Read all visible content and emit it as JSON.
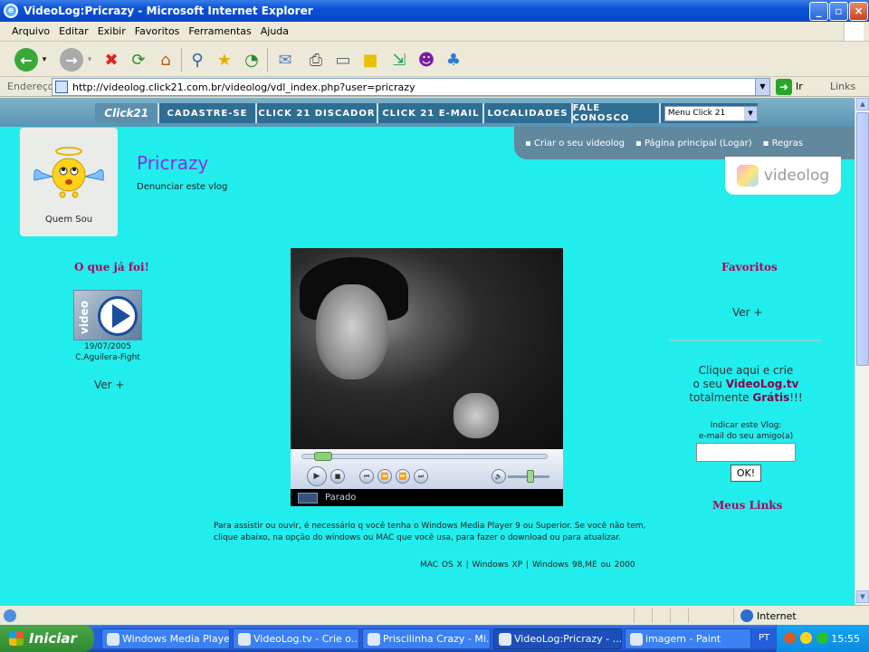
{
  "window": {
    "title": "VideoLog:Pricrazy - Microsoft Internet Explorer"
  },
  "menubar": [
    "Arquivo",
    "Editar",
    "Exibir",
    "Favoritos",
    "Ferramentas",
    "Ajuda"
  ],
  "address": {
    "label": "Endereço",
    "url": "http://videolog.click21.com.br/videolog/vdl_index.php?user=pricrazy",
    "go": "Ir",
    "links": "Links"
  },
  "site": {
    "logo": "Click21",
    "nav": [
      "CADASTRE-SE",
      "CLICK 21 DISCADOR",
      "CLICK 21 E-MAIL",
      "LOCALIDADES",
      "FALE CONOSCO"
    ],
    "menu_select": "Menu Click 21",
    "submenu": [
      "Criar o seu videolog",
      "Página principal (Logar)",
      "Regras"
    ],
    "videolog_logo": "videolog"
  },
  "profile": {
    "label": "Quem Sou",
    "username": "Pricrazy",
    "report": "Denunciar este vlog"
  },
  "left": {
    "heading": "O que já foi!",
    "thumb_label": "video",
    "date": "19/07/2005",
    "title": "C.Aguilera-Fight",
    "more": "Ver +"
  },
  "player": {
    "status": "Parado",
    "progress": 0.05,
    "volume": 0.55
  },
  "info": {
    "text": "Para assistir ou ouvir, é necessário q você tenha o Windows Media Player 9 ou Superior. Se você não tem, clique abaixo, na opção do windows ou MAC que você usa, para fazer o download ou para atualizar.",
    "os_links": [
      "MAC OS X",
      "Windows XP",
      "Windows 98,ME ou 2000"
    ]
  },
  "right": {
    "favorites": "Favoritos",
    "more": "Ver +",
    "cta_1": "Clique aqui e crie",
    "cta_2": "o seu",
    "cta_brand": "VideoLog.tv",
    "cta_3": "totalmente",
    "cta_free": "Grátis",
    "cta_end": "!!!",
    "indicate_1": "Indicar este Vlog:",
    "indicate_2": "e-mail do seu amigo(a)",
    "ok": "OK!",
    "my_links": "Meus Links"
  },
  "statusbar": {
    "zone": "Internet"
  },
  "taskbar": {
    "start": "Iniciar",
    "tasks": [
      "Windows Media Player",
      "VideoLog.tv - Crie o...",
      "Priscilinha Crazy - Mi...",
      "VideoLog:Pricrazy - ...",
      "imagem - Paint"
    ],
    "lang": "PT",
    "clock": "15:55"
  }
}
